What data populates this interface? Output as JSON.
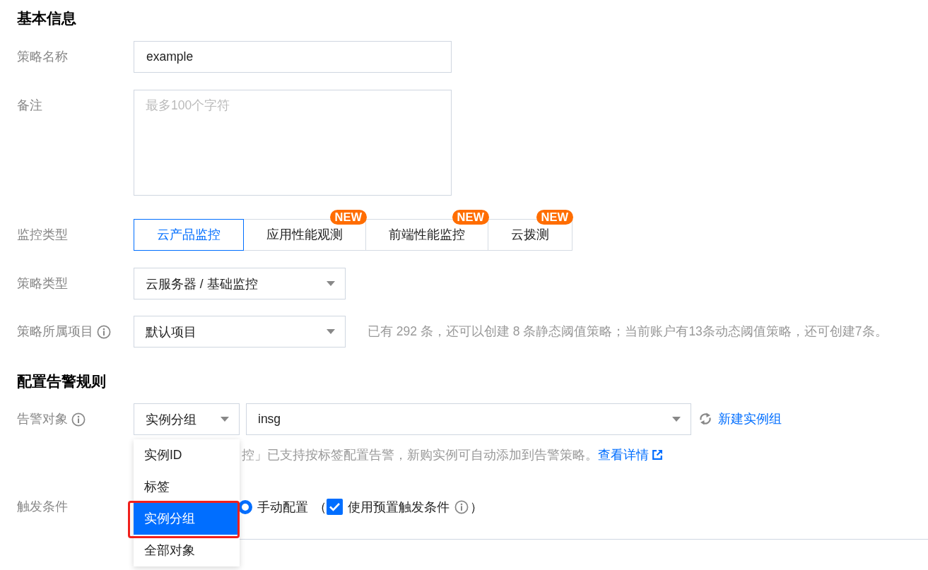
{
  "basic_info": {
    "heading": "基本信息",
    "policy_name": {
      "label": "策略名称",
      "value": "example"
    },
    "remark": {
      "label": "备注",
      "placeholder": "最多100个字符"
    },
    "monitor_type": {
      "label": "监控类型",
      "tabs": [
        {
          "label": "云产品监控",
          "selected": true
        },
        {
          "label": "应用性能观测",
          "selected": false,
          "badge": "NEW"
        },
        {
          "label": "前端性能监控",
          "selected": false,
          "badge": "NEW"
        },
        {
          "label": "云拨测",
          "selected": false,
          "badge": "NEW"
        }
      ]
    },
    "policy_type": {
      "label": "策略类型",
      "value": "云服务器 / 基础监控"
    },
    "project": {
      "label": "策略所属项目",
      "value": "默认项目",
      "hint": "已有 292 条，还可以创建 8 条静态阈值策略；当前账户有13条动态阈值策略，还可创建7条。"
    }
  },
  "alert_rules": {
    "heading": "配置告警规则",
    "alert_object": {
      "label": "告警对象",
      "object_type": "实例分组",
      "group": "insg",
      "create_link": "新建实例组",
      "hint": "控」已支持按标签配置告警，新购实例可自动添加到告警策略。",
      "details_link": "查看详情",
      "dropdown": [
        {
          "label": "实例ID",
          "selected": false,
          "highlighted": false
        },
        {
          "label": "标签",
          "selected": false,
          "highlighted": false
        },
        {
          "label": "实例分组",
          "selected": true,
          "highlighted": true
        },
        {
          "label": "全部对象",
          "selected": false,
          "highlighted": false
        }
      ]
    },
    "trigger": {
      "label": "触发条件",
      "radio": {
        "label": "手动配置",
        "selected": true
      },
      "open_paren": "（",
      "preset": {
        "label": "使用预置触发条件",
        "checked": true
      },
      "close_paren": "）"
    }
  }
}
